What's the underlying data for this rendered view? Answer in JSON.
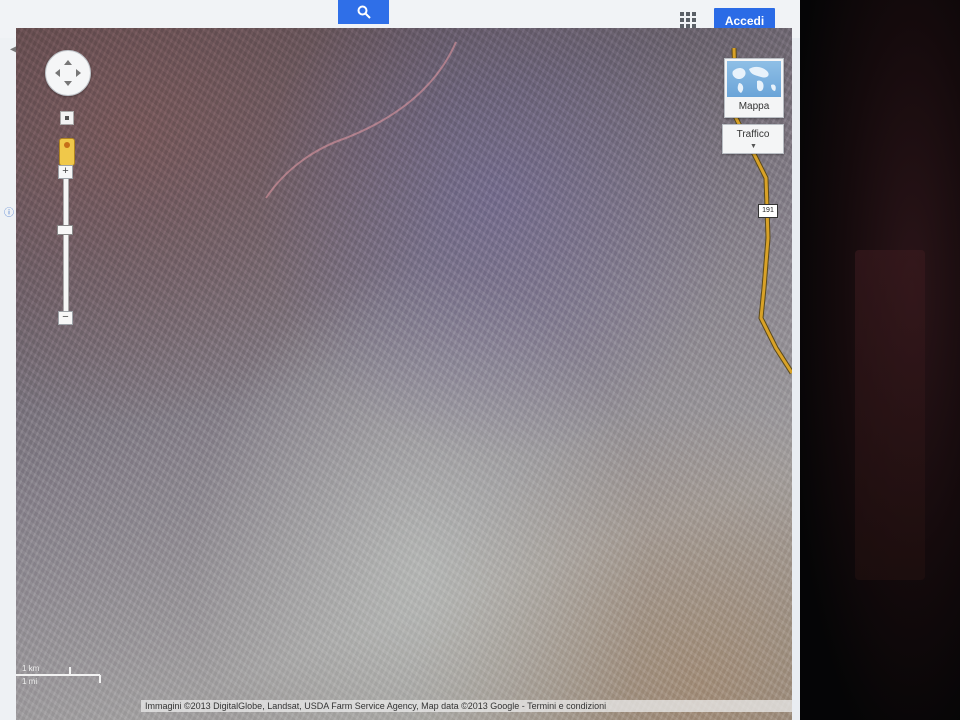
{
  "toolbar": {
    "search_icon": "search-icon",
    "apps_icon": "apps-grid-icon",
    "signin_label": "Accedi",
    "accent_color": "#2b6be6"
  },
  "map": {
    "view": "satellite",
    "controls": {
      "pan_icon": "pan-arrows-icon",
      "zoom_in": "+",
      "zoom_out": "−",
      "pegman_icon": "pegman-icon"
    },
    "maptype": {
      "label": "Mappa",
      "thumb_icon": "world-map-icon"
    },
    "traffic": {
      "label": "Traffico"
    },
    "route_shield": "191",
    "road_color": "#d9a227",
    "scale": {
      "top": "1 km",
      "bottom": "1 mi"
    },
    "attribution": "Immagini ©2013 DigitalGlobe, Landsat, USDA Farm Service Agency, Map data ©2013 Google - Termini e condizioni"
  }
}
